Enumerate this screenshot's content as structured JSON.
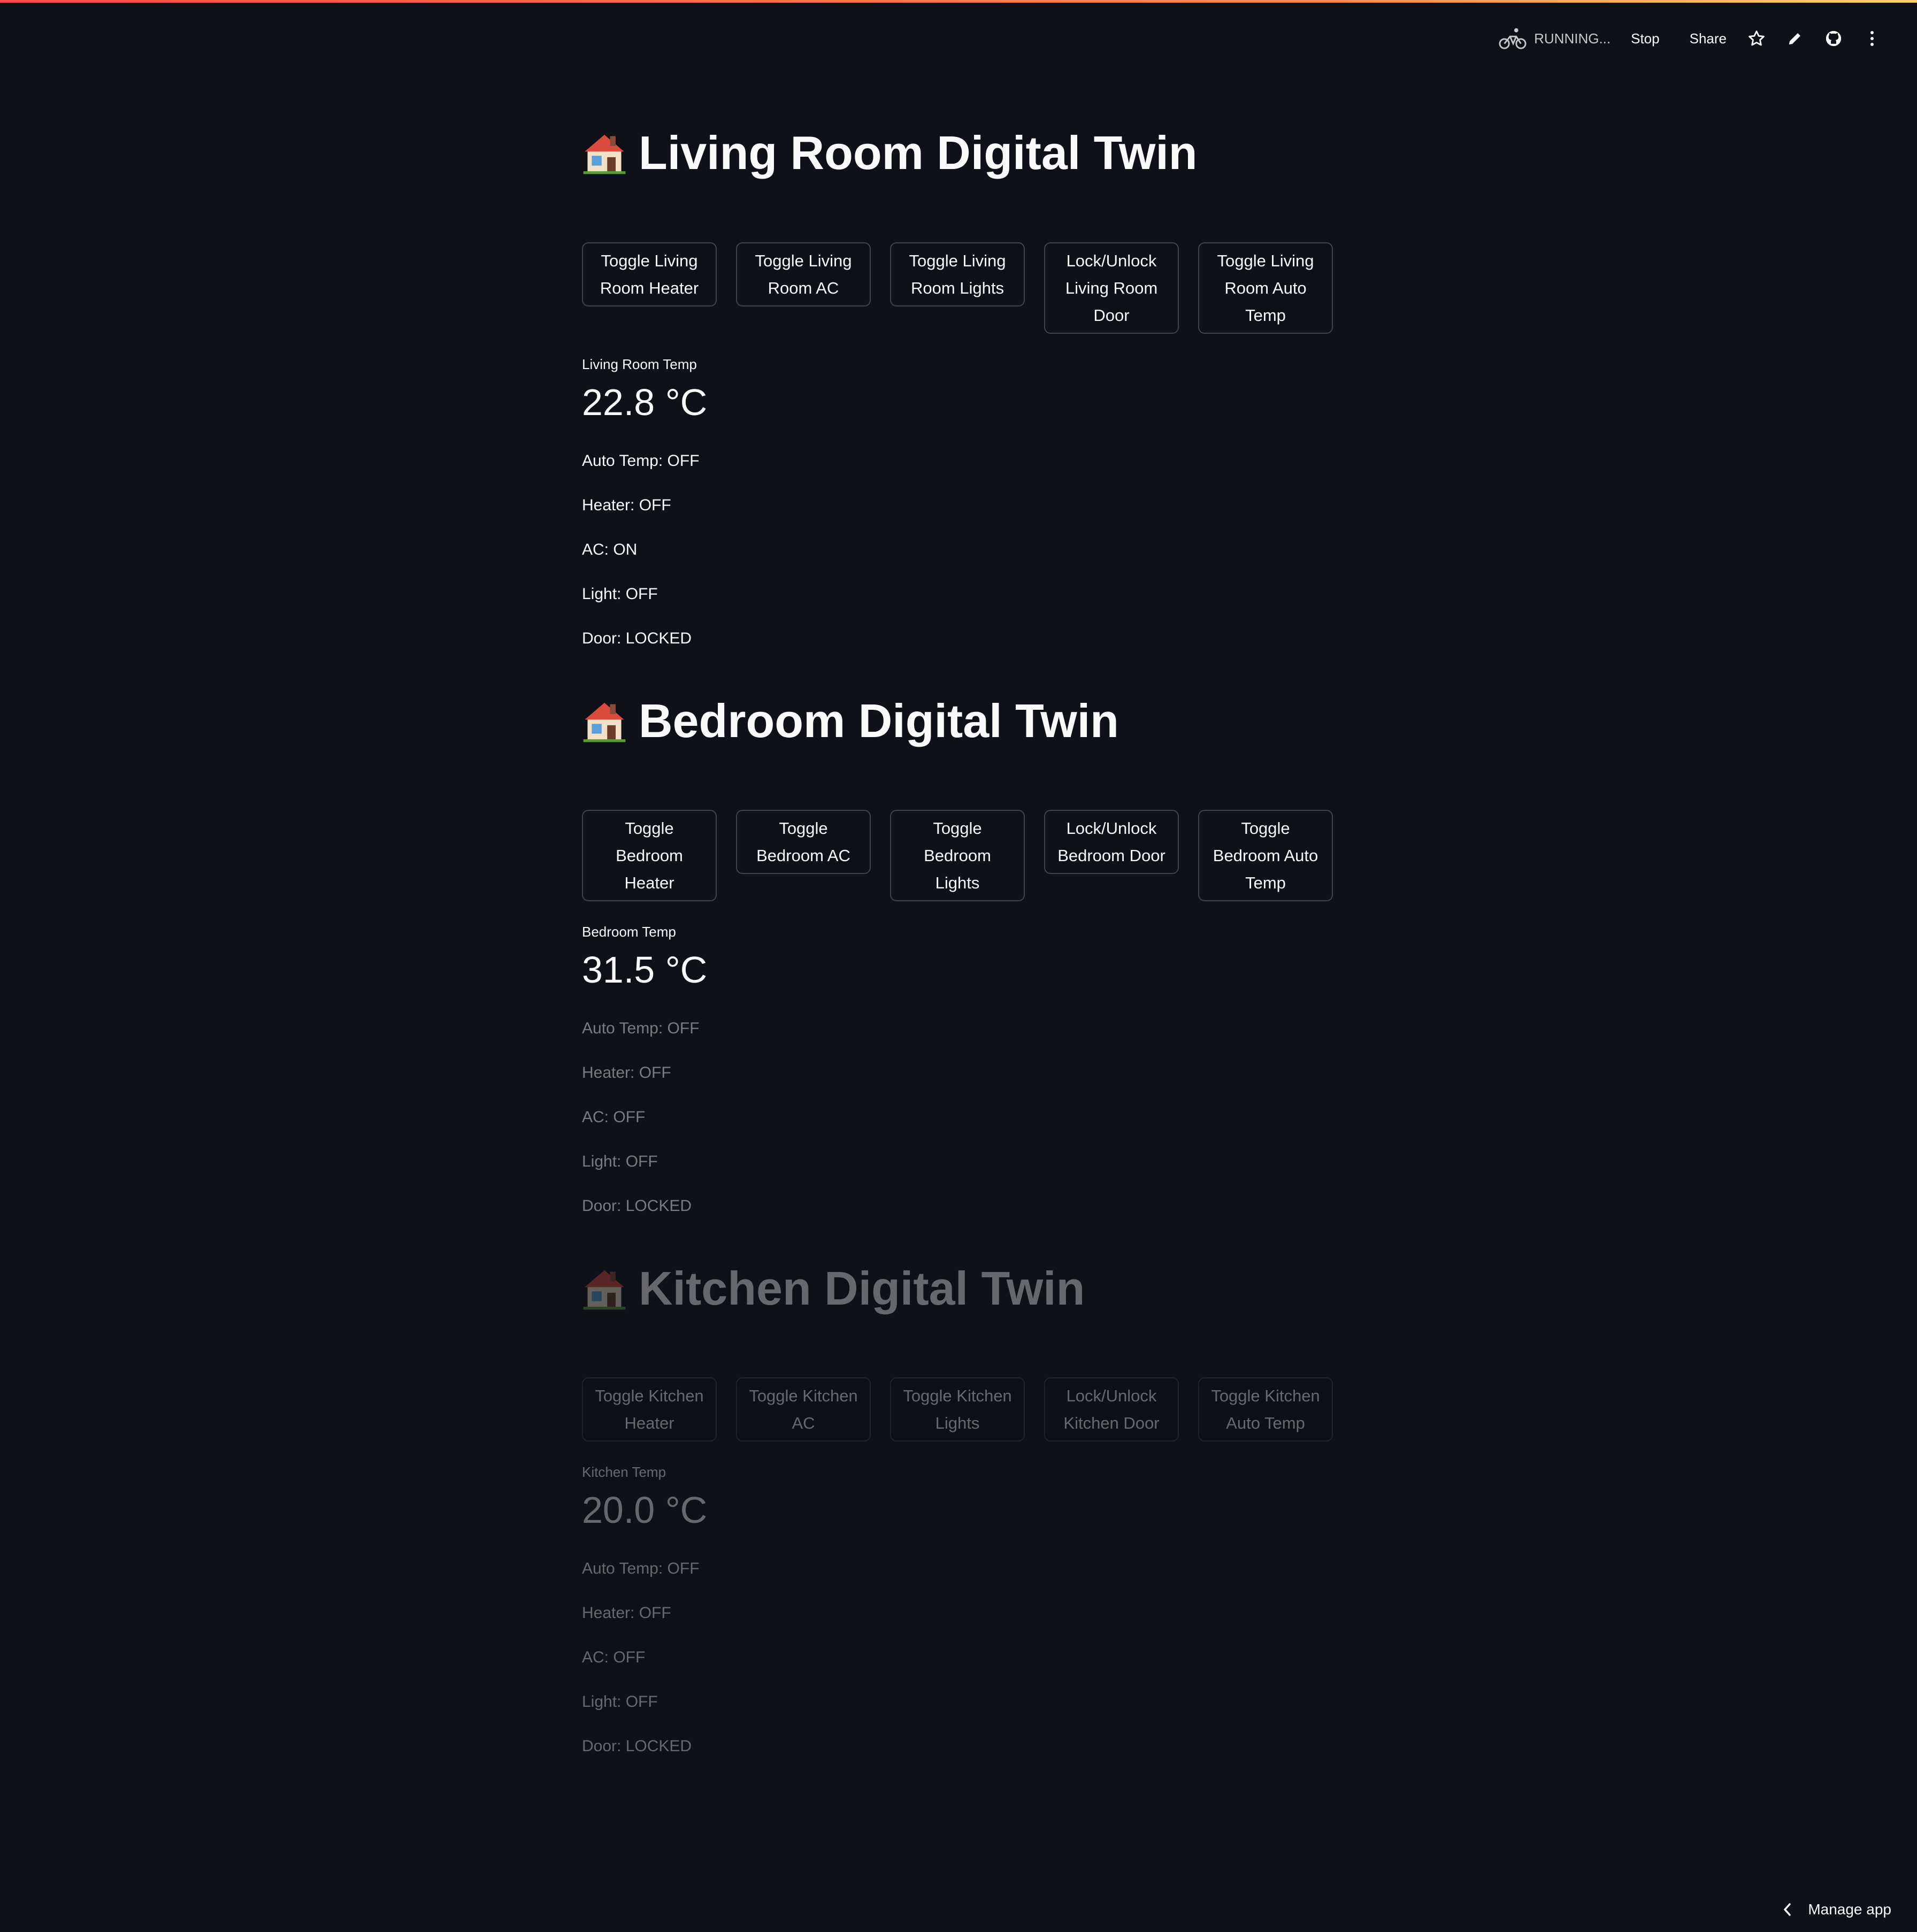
{
  "toolbar": {
    "running_label": "RUNNING...",
    "stop_label": "Stop",
    "share_label": "Share"
  },
  "rooms": [
    {
      "title": "Living Room Digital Twin",
      "buttons": [
        "Toggle Living Room Heater",
        "Toggle Living Room AC",
        "Toggle Living Room Lights",
        "Lock/Unlock Living Room Door",
        "Toggle Living Room Auto Temp"
      ],
      "temp_label": "Living Room Temp",
      "temp_value": "22.8 °C",
      "status": [
        "Auto Temp: OFF",
        "Heater: OFF",
        "AC: ON",
        "Light: OFF",
        "Door: LOCKED"
      ]
    },
    {
      "title": "Bedroom Digital Twin",
      "buttons": [
        "Toggle Bedroom Heater",
        "Toggle Bedroom AC",
        "Toggle Bedroom Lights",
        "Lock/Unlock Bedroom Door",
        "Toggle Bedroom Auto Temp"
      ],
      "temp_label": "Bedroom Temp",
      "temp_value": "31.5 °C",
      "status": [
        "Auto Temp: OFF",
        "Heater: OFF",
        "AC: OFF",
        "Light: OFF",
        "Door: LOCKED"
      ]
    },
    {
      "title": "Kitchen Digital Twin",
      "buttons": [
        "Toggle Kitchen Heater",
        "Toggle Kitchen AC",
        "Toggle Kitchen Lights",
        "Lock/Unlock Kitchen Door",
        "Toggle Kitchen Auto Temp"
      ],
      "temp_label": "Kitchen Temp",
      "temp_value": "20.0 °C",
      "status": [
        "Auto Temp: OFF",
        "Heater: OFF",
        "AC: OFF",
        "Light: OFF",
        "Door: LOCKED"
      ]
    }
  ],
  "footer": {
    "manage_label": "Manage app"
  },
  "colors": {
    "background": "#0e1117",
    "text": "#fafafa",
    "border": "#3d4250",
    "accent_gradient_start": "#ff4b4b",
    "accent_gradient_end": "#ffd16a"
  },
  "icons": [
    "running-bike-icon",
    "star-icon",
    "edit-pencil-icon",
    "github-icon",
    "more-vertical-icon",
    "house-icon",
    "chevron-left-icon"
  ]
}
